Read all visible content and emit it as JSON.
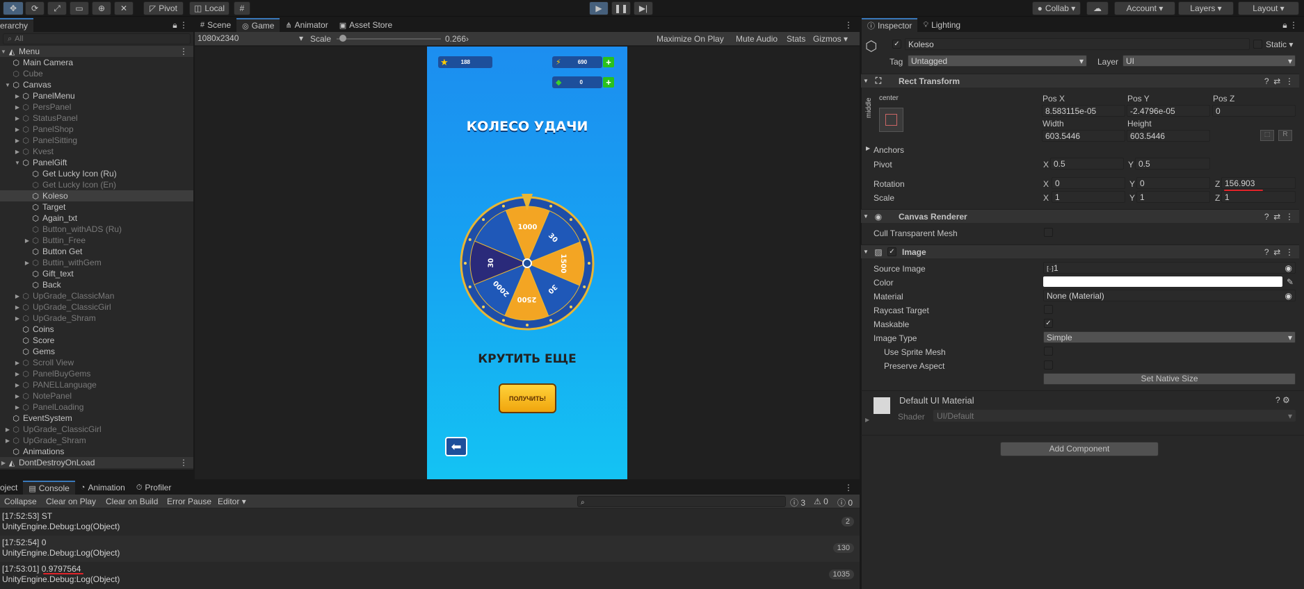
{
  "toolbar": {
    "pivot": "Pivot",
    "local": "Local",
    "collab": "Collab",
    "account": "Account",
    "layers": "Layers",
    "layout": "Layout"
  },
  "hierarchy": {
    "tab": "erarchy",
    "search_placeholder": "All",
    "scene": "Menu",
    "items": [
      {
        "label": "Main Camera",
        "dim": false
      },
      {
        "label": "Cube",
        "dim": true
      },
      {
        "label": "Canvas",
        "dim": false
      },
      {
        "label": "PanelMenu",
        "dim": false
      },
      {
        "label": "PersPanel",
        "dim": true
      },
      {
        "label": "StatusPanel",
        "dim": true
      },
      {
        "label": "PanelShop",
        "dim": true
      },
      {
        "label": "PanelSitting",
        "dim": true
      },
      {
        "label": "Kvest",
        "dim": true
      },
      {
        "label": "PanelGift",
        "dim": false
      },
      {
        "label": "Get Lucky Icon (Ru)",
        "dim": false
      },
      {
        "label": "Get Lucky Icon (En)",
        "dim": true
      },
      {
        "label": "Koleso",
        "dim": false
      },
      {
        "label": "Target",
        "dim": false
      },
      {
        "label": "Again_txt",
        "dim": false
      },
      {
        "label": "Button_withADS (Ru)",
        "dim": true
      },
      {
        "label": "Buttin_Free",
        "dim": true
      },
      {
        "label": "Button Get",
        "dim": false
      },
      {
        "label": "Buttin_withGem",
        "dim": true
      },
      {
        "label": "Gift_text",
        "dim": false
      },
      {
        "label": "Back",
        "dim": false
      },
      {
        "label": "UpGrade_ClassicMan",
        "dim": true
      },
      {
        "label": "UpGrade_ClassicGirl",
        "dim": true
      },
      {
        "label": "UpGrade_Shram",
        "dim": true
      },
      {
        "label": "Coins",
        "dim": false
      },
      {
        "label": "Score",
        "dim": false
      },
      {
        "label": "Gems",
        "dim": false
      },
      {
        "label": "Scroll View",
        "dim": true
      },
      {
        "label": "PanelBuyGems",
        "dim": true
      },
      {
        "label": "PANELLanguage",
        "dim": true
      },
      {
        "label": "NotePanel",
        "dim": true
      },
      {
        "label": "PanelLoading",
        "dim": true
      },
      {
        "label": "EventSystem",
        "dim": false
      },
      {
        "label": "UpGrade_ClassicGirl",
        "dim": true
      },
      {
        "label": "UpGrade_Shram",
        "dim": true
      },
      {
        "label": "Animations",
        "dim": false
      }
    ],
    "dontdestroy": "DontDestroyOnLoad"
  },
  "center_tabs": {
    "scene": "Scene",
    "game": "Game",
    "animator": "Animator",
    "asset_store": "Asset Store"
  },
  "game_toolbar": {
    "resolution": "1080x2340",
    "scale_label": "Scale",
    "scale_value": "0.266",
    "scale_level": 0.02,
    "maximize": "Maximize On Play",
    "mute": "Mute Audio",
    "stats": "Stats",
    "gizmos": "Gizmos"
  },
  "game": {
    "stars": "188",
    "energy": "690",
    "gems": "0",
    "title": "КОЛЕСО УДАЧИ",
    "again": "КРУТИТЬ ЕЩЕ",
    "get_button": "ПОЛУЧИТЬ!",
    "wheel_labels": [
      "1000",
      "30",
      "1500",
      "30",
      "2500",
      "2000",
      "30"
    ]
  },
  "inspector": {
    "tab": "Inspector",
    "lighting": "Lighting",
    "object_name": "Koleso",
    "static": "Static",
    "tag_label": "Tag",
    "tag": "Untagged",
    "layer_label": "Layer",
    "layer": "UI",
    "rect": {
      "title": "Rect Transform",
      "anchor_h": "center",
      "anchor_v": "middle",
      "posx_label": "Pos X",
      "posx": "8.583115e-05",
      "posy_label": "Pos Y",
      "posy": "-2.4796e-05",
      "posz_label": "Pos Z",
      "posz": "0",
      "width_label": "Width",
      "width": "603.5446",
      "height_label": "Height",
      "height": "603.5446",
      "anchors": "Anchors",
      "pivot": "Pivot",
      "pivot_x": "0.5",
      "pivot_y": "0.5",
      "rotation": "Rotation",
      "rot_x": "0",
      "rot_y": "0",
      "rot_z": "156.903",
      "scale": "Scale",
      "scale_x": "1",
      "scale_y": "1",
      "scale_z": "1",
      "r_btn": "R"
    },
    "canvas_renderer": {
      "title": "Canvas Renderer",
      "cull": "Cull Transparent Mesh"
    },
    "image": {
      "title": "Image",
      "source_label": "Source Image",
      "source": "1",
      "color_label": "Color",
      "material_label": "Material",
      "material": "None (Material)",
      "raycast": "Raycast Target",
      "maskable": "Maskable",
      "type_label": "Image Type",
      "type": "Simple",
      "sprite_mesh": "Use Sprite Mesh",
      "preserve": "Preserve Aspect",
      "native": "Set Native Size"
    },
    "material": {
      "name": "Default UI Material",
      "shader_label": "Shader",
      "shader": "UI/Default"
    },
    "add_component": "Add Component"
  },
  "console": {
    "tabs": [
      "oject",
      "Console",
      "Animation",
      "Profiler"
    ],
    "buttons": [
      "Collapse",
      "Clear on Play",
      "Clear on Build",
      "Error Pause",
      "Editor"
    ],
    "counts": {
      "info": "3",
      "warn": "0",
      "error": "0"
    },
    "logs": [
      {
        "line1": "[17:52:53] ST",
        "line2": "UnityEngine.Debug:Log(Object)",
        "count": "2"
      },
      {
        "line1": "[17:52:54] 0",
        "line2": "UnityEngine.Debug:Log(Object)",
        "count": "130"
      },
      {
        "line1": "[17:53:01] 0.9797564",
        "line2": "UnityEngine.Debug:Log(Object)",
        "count": "1035"
      }
    ]
  },
  "colors": {
    "accent": "#3a79bb",
    "annotation": "#e0242a"
  }
}
